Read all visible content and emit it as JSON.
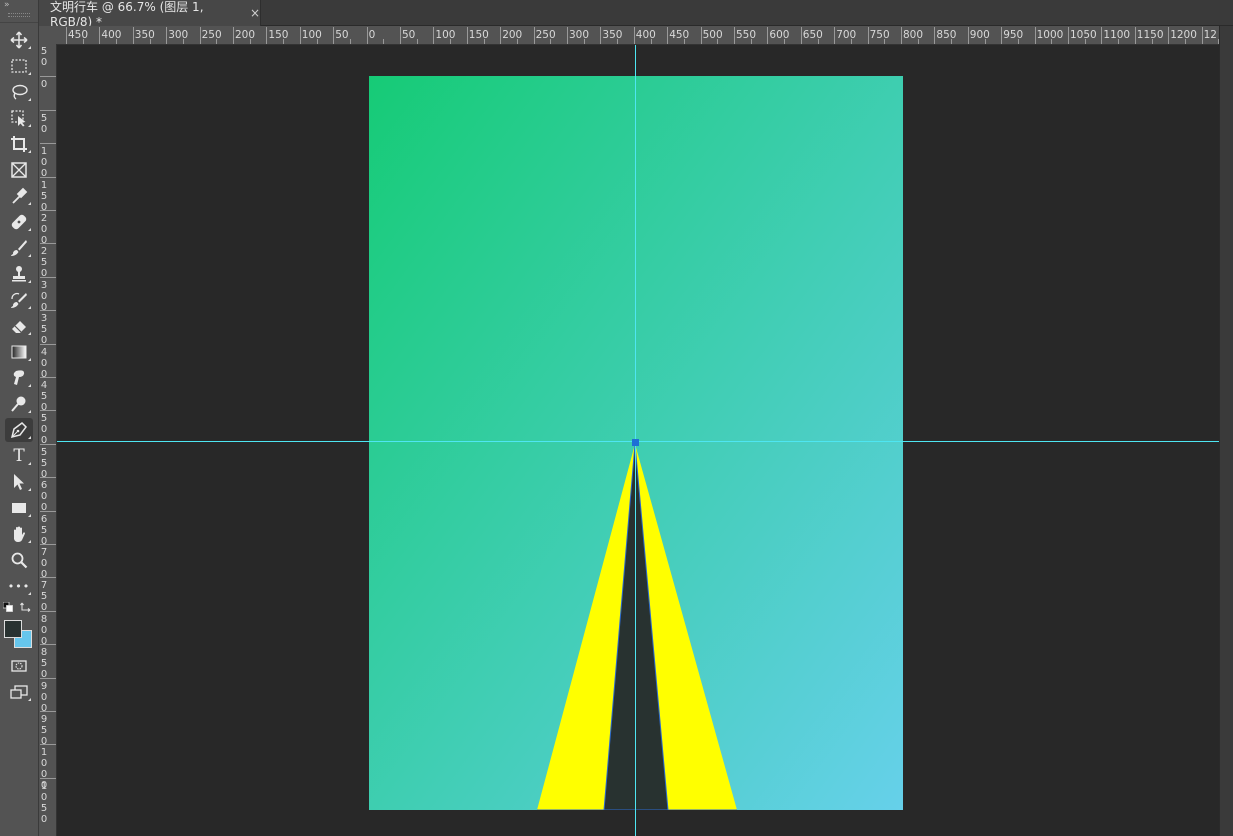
{
  "document_tab": {
    "title": "文明行车 @ 66.7% (图层 1, RGB/8) *",
    "close_glyph": "×"
  },
  "toolbar": {
    "tools": [
      {
        "name": "move-icon",
        "label": "Move Tool"
      },
      {
        "name": "marquee-icon",
        "label": "Rectangular Marquee Tool"
      },
      {
        "name": "lasso-icon",
        "label": "Lasso Tool"
      },
      {
        "name": "object-select-icon",
        "label": "Object Selection Tool"
      },
      {
        "name": "crop-icon",
        "label": "Crop Tool"
      },
      {
        "name": "frame-icon",
        "label": "Frame Tool"
      },
      {
        "name": "eyedropper-icon",
        "label": "Eyedropper Tool"
      },
      {
        "name": "healing-brush-icon",
        "label": "Spot Healing Brush Tool"
      },
      {
        "name": "brush-icon",
        "label": "Brush Tool"
      },
      {
        "name": "clone-stamp-icon",
        "label": "Clone Stamp Tool"
      },
      {
        "name": "history-brush-icon",
        "label": "History Brush Tool"
      },
      {
        "name": "eraser-icon",
        "label": "Eraser Tool"
      },
      {
        "name": "gradient-icon",
        "label": "Gradient Tool"
      },
      {
        "name": "smudge-icon",
        "label": "Smudge Tool"
      },
      {
        "name": "dodge-icon",
        "label": "Dodge Tool"
      },
      {
        "name": "pen-icon",
        "label": "Pen Tool",
        "active": true
      },
      {
        "name": "type-icon",
        "label": "Horizontal Type Tool",
        "glyph": "T"
      },
      {
        "name": "path-select-icon",
        "label": "Path Selection Tool"
      },
      {
        "name": "rectangle-icon",
        "label": "Rectangle Tool"
      },
      {
        "name": "hand-icon",
        "label": "Hand Tool"
      },
      {
        "name": "zoom-icon",
        "label": "Zoom Tool"
      },
      {
        "name": "more-tools-icon",
        "label": "Edit Toolbar",
        "glyph": "•••"
      }
    ],
    "foreground_color": "#293231",
    "background_color": "#66c6ec"
  },
  "ruler": {
    "horizontal_labels": [
      "450",
      "400",
      "350",
      "300",
      "250",
      "200",
      "150",
      "100",
      "50",
      "0",
      "50",
      "100",
      "150",
      "200",
      "250",
      "300",
      "350",
      "400",
      "450",
      "500",
      "550",
      "600",
      "650",
      "700",
      "750",
      "800",
      "850",
      "900",
      "950",
      "1000",
      "1050",
      "1100",
      "1150",
      "1200",
      "12"
    ],
    "vertical_labels": [
      "5\n0",
      "0",
      "5\n0",
      "1\n0\n0",
      "1\n5\n0",
      "2\n0\n0",
      "2\n5\n0",
      "3\n0\n0",
      "3\n5\n0",
      "4\n0\n0",
      "4\n5\n0",
      "5\n0\n0",
      "5\n5\n0",
      "6\n0\n0",
      "6\n5\n0",
      "7\n0\n0",
      "7\n5\n0",
      "8\n0\n0",
      "8\n5\n0",
      "9\n0\n0",
      "9\n5\n0",
      "1\n0\n0\n0",
      "1\n0\n5\n0"
    ]
  },
  "canvas": {
    "gradient_start": "#16cb76",
    "gradient_end": "#66d0ea",
    "road_edge_color": "#ffff00",
    "road_center_color": "#283230",
    "guide_color": "#4ee6f2",
    "anchor_color": "#1e6fd6"
  }
}
